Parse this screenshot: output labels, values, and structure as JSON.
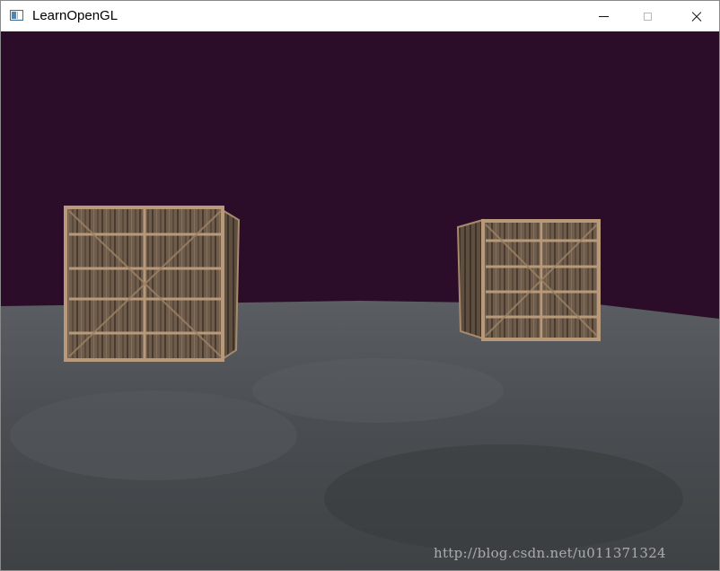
{
  "window": {
    "title": "LearnOpenGL",
    "icon": "opengl-window-icon",
    "controls": {
      "minimize": "minimize-icon",
      "maximize": "maximize-icon",
      "close": "close-icon"
    }
  },
  "scene": {
    "background_color": "#2b0d29",
    "floor_color": "#4a4d50",
    "crate_color": "#6b5a4a",
    "objects": [
      "wooden-crate",
      "wooden-crate",
      "concrete-floor"
    ]
  },
  "watermark": {
    "text": "http://blog.csdn.net/u011371324"
  }
}
